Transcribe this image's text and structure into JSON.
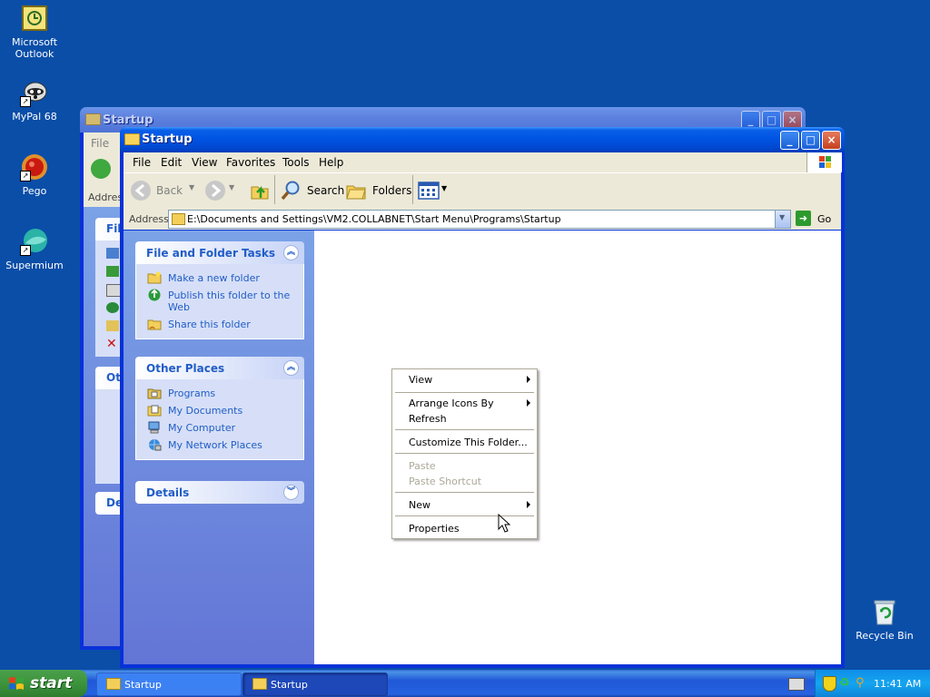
{
  "desktop": {
    "icons": [
      {
        "label": "Microsoft Outlook",
        "icon": "outlook-icon"
      },
      {
        "label": "MyPal 68",
        "icon": "mypal-icon"
      },
      {
        "label": "Pego",
        "icon": "pego-icon"
      },
      {
        "label": "Supermium",
        "icon": "supermium-icon"
      },
      {
        "label": "Recycle Bin",
        "icon": "recycle-bin-icon"
      }
    ]
  },
  "back_window": {
    "title": "Startup",
    "menu_first": "File",
    "address_label": "Addres",
    "panel1_title": "File",
    "panel2_title": "Oth",
    "panel3_title": "De"
  },
  "window": {
    "title": "Startup",
    "menu": [
      "File",
      "Edit",
      "View",
      "Favorites",
      "Tools",
      "Help"
    ],
    "toolbar": {
      "back": "Back",
      "search": "Search",
      "folders": "Folders"
    },
    "address": {
      "label": "Address",
      "value": "E:\\Documents and Settings\\VM2.COLLABNET\\Start Menu\\Programs\\Startup",
      "go": "Go"
    },
    "tasks": {
      "file_folder": {
        "title": "File and Folder Tasks",
        "items": [
          "Make a new folder",
          "Publish this folder to the Web",
          "Share this folder"
        ]
      },
      "other_places": {
        "title": "Other Places",
        "items": [
          "Programs",
          "My Documents",
          "My Computer",
          "My Network Places"
        ]
      },
      "details": {
        "title": "Details"
      }
    }
  },
  "context_menu": {
    "view": "View",
    "arrange": "Arrange Icons By",
    "refresh": "Refresh",
    "customize": "Customize This Folder...",
    "paste": "Paste",
    "paste_shortcut": "Paste Shortcut",
    "new": "New",
    "properties": "Properties"
  },
  "taskbar": {
    "start": "start",
    "items": [
      "Startup",
      "Startup"
    ],
    "clock": "11:41 AM"
  },
  "colors": {
    "desktop": "#0a4ea8",
    "titlebar": "#0054e3",
    "task_link": "#215dc6",
    "taskbar": "#2157d7",
    "start_button": "#3c943c"
  }
}
